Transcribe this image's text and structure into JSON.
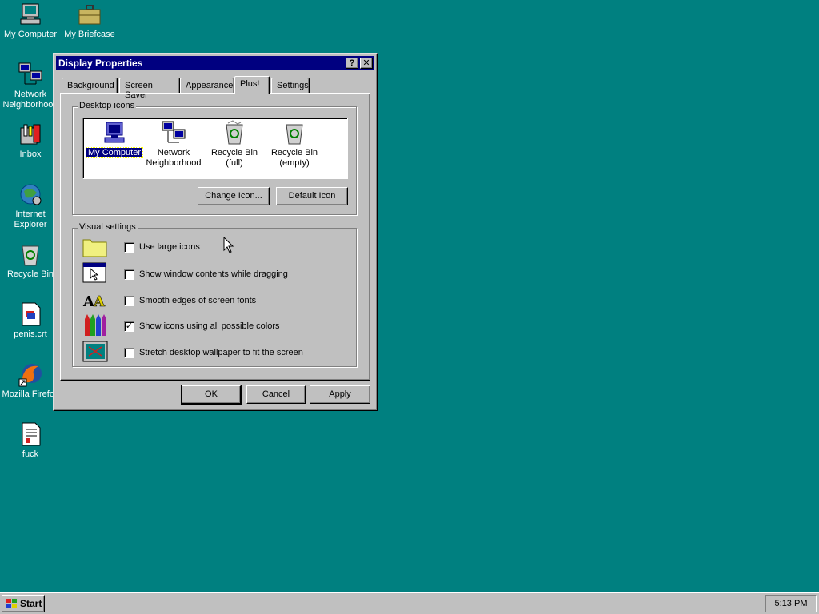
{
  "desktop": {
    "icons": [
      {
        "label": "My Computer",
        "icon": "computer-icon"
      },
      {
        "label": "My Briefcase",
        "icon": "briefcase-icon"
      },
      {
        "label": "Network Neighborhood",
        "icon": "network-icon"
      },
      {
        "label": "Inbox",
        "icon": "inbox-icon"
      },
      {
        "label": "Internet Explorer",
        "icon": "internet-explorer-icon"
      },
      {
        "label": "Recycle Bin",
        "icon": "recycle-bin-icon"
      },
      {
        "label": "penis.crt",
        "icon": "certificate-file-icon"
      },
      {
        "label": "Mozilla Firefox",
        "icon": "firefox-icon"
      },
      {
        "label": "fuck",
        "icon": "document-icon"
      }
    ]
  },
  "window": {
    "title": "Display Properties",
    "help_btn": "?",
    "close_btn": "✕",
    "tabs": [
      "Background",
      "Screen Saver",
      "Appearance",
      "Plus!",
      "Settings"
    ],
    "active_tab": "Plus!",
    "desktop_icons_group": "Desktop icons",
    "icon_list": [
      {
        "label": "My Computer",
        "selected": true
      },
      {
        "label": "Network Neighborhood",
        "selected": false
      },
      {
        "label": "Recycle Bin (full)",
        "selected": false
      },
      {
        "label": "Recycle Bin (empty)",
        "selected": false
      }
    ],
    "change_icon": "Change Icon...",
    "default_icon": "Default Icon",
    "visual_settings_group": "Visual settings",
    "settings": [
      {
        "label": "Use large icons",
        "checked": false
      },
      {
        "label": "Show window contents while dragging",
        "checked": false
      },
      {
        "label": "Smooth edges of screen fonts",
        "checked": false
      },
      {
        "label": "Show icons using all possible colors",
        "checked": true
      },
      {
        "label": "Stretch desktop wallpaper to fit the screen",
        "checked": false
      }
    ],
    "ok": "OK",
    "cancel": "Cancel",
    "apply": "Apply"
  },
  "taskbar": {
    "start_label": "Start",
    "clock": "5:13 PM"
  },
  "colors": {
    "desktop": "#008080",
    "title_active": "#000080",
    "face": "#c0c0c0"
  }
}
